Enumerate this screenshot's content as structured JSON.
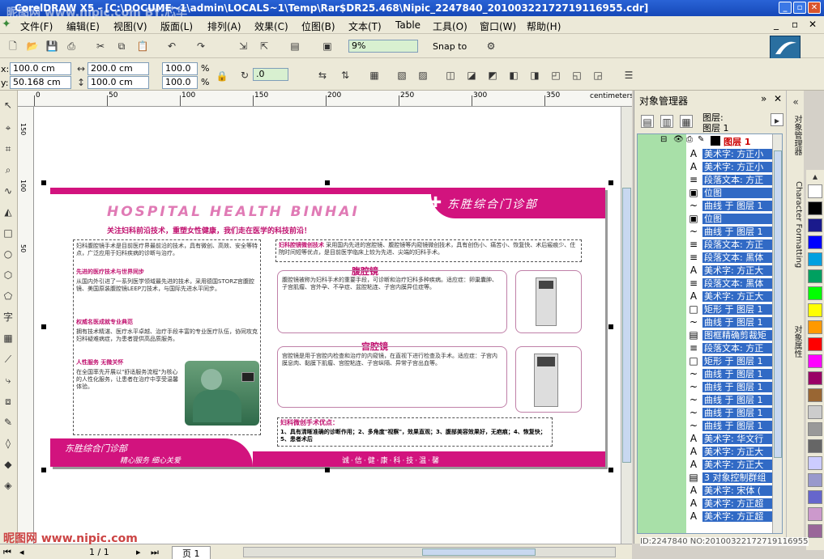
{
  "title_bar": {
    "title": "CorelDRAW X5 - [C:\\DOCUME~1\\admin\\LOCALS~1\\Temp\\Rar$DR25.468\\Nipic_2247840_20100322172719116955.cdr]",
    "watermark": "昵图网 www.nipic.com  BY:芯华"
  },
  "menu": {
    "items": [
      "文件(F)",
      "编辑(E)",
      "视图(V)",
      "版面(L)",
      "排列(A)",
      "效果(C)",
      "位图(B)",
      "文本(T)",
      "Table",
      "工具(O)",
      "窗口(W)",
      "帮助(H)"
    ]
  },
  "toolbar": {
    "zoom": "9%",
    "snap_to": "Snap to"
  },
  "property_bar": {
    "x": "100.0 cm",
    "y": "50.168 cm",
    "w": "200.0 cm",
    "h": "100.0 cm",
    "scale_x": "100.0",
    "scale_y": "100.0",
    "pct": "%",
    "angle": ".0"
  },
  "ruler": {
    "units": "centimeters",
    "h_labels": [
      "0",
      "50",
      "100",
      "150",
      "200",
      "250",
      "300",
      "350"
    ],
    "v_labels": [
      "150",
      "100",
      "50"
    ]
  },
  "document": {
    "header_brand": "东胜综合门诊部",
    "header_en": "HOSPITAL    HEALTH  BINHAI",
    "slogan": "关注妇科前沿技术，重塑女性健康，我们走在医学的科技前沿！",
    "intro_title": "妇科腔镜微创技术",
    "intro_text": "采用国内先进的宫腔镜、腹腔镜等内窥镜微创技术，具有创伤小、痛苦小、恢复快、术后瘢痕少、住院时间短等优点，是目前医学临床上较为先进、尖端的妇科手术。",
    "left_text_1": "妇科腹腔镜手术是目前医疗界最前沿的技术，具有微创、高效、安全等特点，广泛应用于妇科疾病的诊断与治疗。",
    "left_heading_1": "先进的医疗技术与世界同步",
    "left_text_2": "从国内外引进了一系列医学领域最先进的技术，采用德国STORZ宫腹腔镜、美国原装腹腔镜LEEP刀技术，与国际先进水平同步。",
    "left_heading_2": "权威名医成就专业典范",
    "left_text_3": "拥有技术精湛、医疗水平卓越、治疗手段丰富的专业医疗队伍，协同攻克妇科疑难病症，为患者提供高品质服务。",
    "left_heading_3": "人性服务 无微关怀",
    "left_text_4": "在全国率先开展以\"舒适服务流程\"为核心的人性化服务，让患者在治疗中享受温馨体验。",
    "laparoscope_title": "腹腔镜",
    "laparoscope_text": "腹腔镜被称为妇科手术的重要手段，可诊断和治疗妇科多种疾病。适应症：卵巢囊肿、子宫肌瘤、宫外孕、不孕症、盆腔粘连、子宫内膜异位症等。",
    "hysteroscope_title": "宫腔镜",
    "hysteroscope_text": "宫腔镜是用于宫腔内检查和治疗的内窥镜，在直视下进行检查及手术。适应症：子宫内膜息肉、黏膜下肌瘤、宫腔粘连、子宫纵隔、异常子宫出血等。",
    "advantages_title": "妇科微创手术优点：",
    "advantages_text": "1、具有清晰准确的诊断作用；2、多角度\"视察\"，效果直观；3、腹部美容效果好，无疤痕；4、恢复快；5、患者术后",
    "footer_brand": "东胜综合门诊部",
    "footer_sub": "精心服务 细心关爱",
    "footer_slogan": "诚·信·健·康·科·技·温·馨"
  },
  "object_manager": {
    "title": "对象管理器",
    "page_label": "图层:",
    "layer_label": "图层 1",
    "layer_name": "图层 1",
    "items": [
      {
        "icon": "A",
        "label": "美术字: 方正小"
      },
      {
        "icon": "A",
        "label": "美术字: 方正小"
      },
      {
        "icon": "≡",
        "label": "段落文本: 方正"
      },
      {
        "icon": "▣",
        "label": "位图"
      },
      {
        "icon": "~",
        "label": "曲线 于 图层 1"
      },
      {
        "icon": "▣",
        "label": "位图"
      },
      {
        "icon": "~",
        "label": "曲线 于 图层 1"
      },
      {
        "icon": "≡",
        "label": "段落文本: 方正"
      },
      {
        "icon": "≡",
        "label": "段落文本: 黑体"
      },
      {
        "icon": "A",
        "label": "美术字: 方正大"
      },
      {
        "icon": "≡",
        "label": "段落文本: 黑体"
      },
      {
        "icon": "A",
        "label": "美术字: 方正大"
      },
      {
        "icon": "□",
        "label": "矩形 于 图层 1"
      },
      {
        "icon": "~",
        "label": "曲线 于 图层 1"
      },
      {
        "icon": "▤",
        "label": "图框精确剪裁矩"
      },
      {
        "icon": "≡",
        "label": "段落文本: 方正"
      },
      {
        "icon": "□",
        "label": "矩形 于 图层 1"
      },
      {
        "icon": "~",
        "label": "曲线 于 图层 1"
      },
      {
        "icon": "~",
        "label": "曲线 于 图层 1"
      },
      {
        "icon": "~",
        "label": "曲线 于 图层 1"
      },
      {
        "icon": "~",
        "label": "曲线 于 图层 1"
      },
      {
        "icon": "~",
        "label": "曲线 于 图层 1"
      },
      {
        "icon": "A",
        "label": "美术字: 华文行"
      },
      {
        "icon": "A",
        "label": "美术字: 方正大"
      },
      {
        "icon": "A",
        "label": "美术字: 方正大"
      },
      {
        "icon": "▤",
        "label": "3 对象控制群组"
      },
      {
        "icon": "A",
        "label": "美术字: 宋体 ("
      },
      {
        "icon": "A",
        "label": "美术字: 方正超"
      },
      {
        "icon": "A",
        "label": "美术字: 方正超"
      }
    ]
  },
  "side_tabs": [
    "对象管理器",
    "Character Formatting",
    "对象属性"
  ],
  "status": {
    "page_nav": "1 / 1",
    "page_tab": "页 1",
    "watermark_bottom": "昵图网 www.nipic.com",
    "id_text": "ID:2247840 NO:20100322172719116955"
  },
  "palette_colors": [
    "#ffffff",
    "#000000",
    "#1a1a8c",
    "#0000ff",
    "#00a0e0",
    "#00a060",
    "#00ff00",
    "#ffff00",
    "#ff9900",
    "#ff0000",
    "#ff00ff",
    "#990066",
    "#996633",
    "#cccccc",
    "#999999",
    "#666666",
    "#ccccff",
    "#9999cc",
    "#6666cc",
    "#cc99cc",
    "#996699"
  ]
}
